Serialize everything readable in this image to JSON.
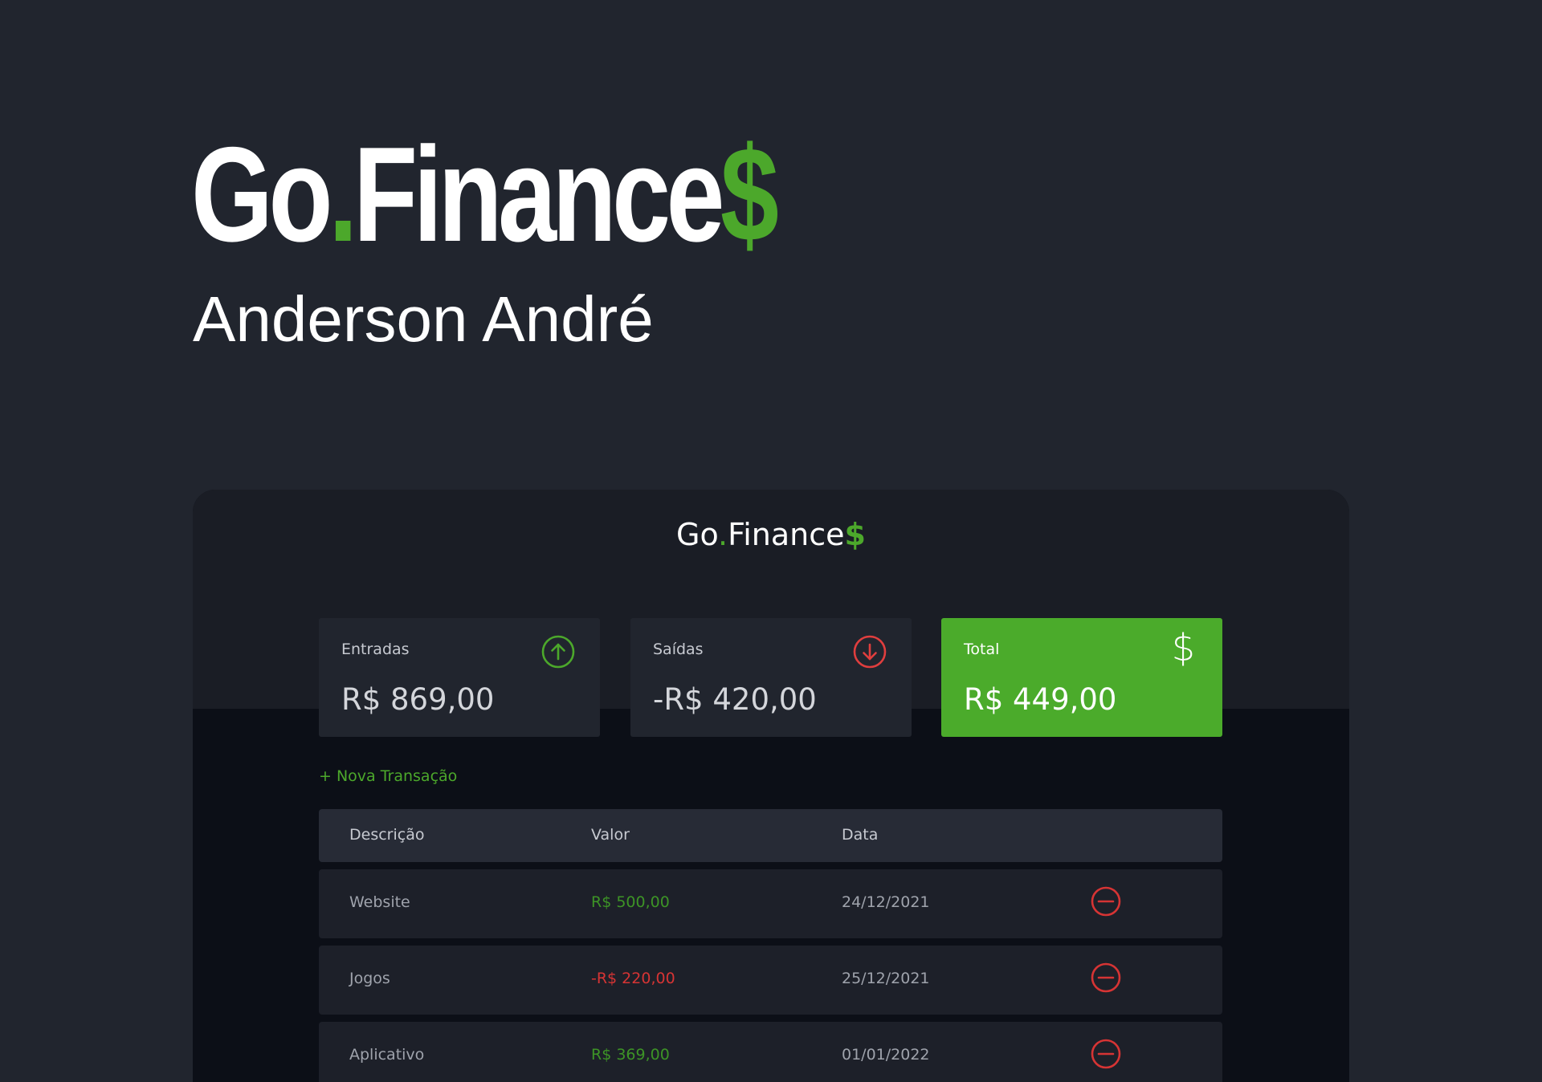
{
  "hero": {
    "title_main": "Go",
    "title_dot": ".",
    "title_rest": "Finance",
    "title_dollar": "$",
    "author": "Anderson André"
  },
  "app": {
    "logo_main": "Go",
    "logo_dot": ".",
    "logo_rest": "Finance",
    "logo_dollar": "$",
    "cards": {
      "entradas": {
        "label": "Entradas",
        "value": "R$ 869,00",
        "icon": "arrow-up-circle-icon"
      },
      "saidas": {
        "label": "Saídas",
        "value": "-R$ 420,00",
        "icon": "arrow-down-circle-icon"
      },
      "total": {
        "label": "Total",
        "value": "R$ 449,00",
        "icon_glyph": "$"
      }
    },
    "new_transaction_label": "+ Nova Transação",
    "table": {
      "headers": {
        "description": "Descrição",
        "value": "Valor",
        "date": "Data"
      },
      "rows": [
        {
          "description": "Website",
          "value": "R$ 500,00",
          "date": "24/12/2021",
          "type": "income"
        },
        {
          "description": "Jogos",
          "value": "-R$ 220,00",
          "date": "25/12/2021",
          "type": "expense"
        },
        {
          "description": "Aplicativo",
          "value": "R$ 369,00",
          "date": "01/01/2022",
          "type": "income"
        }
      ]
    },
    "colors": {
      "background": "#21252e",
      "accent_green": "#4ca82b",
      "expense_red": "#d63434",
      "card_bg": "#21252e",
      "total_card_bg": "#4bab2b"
    }
  }
}
